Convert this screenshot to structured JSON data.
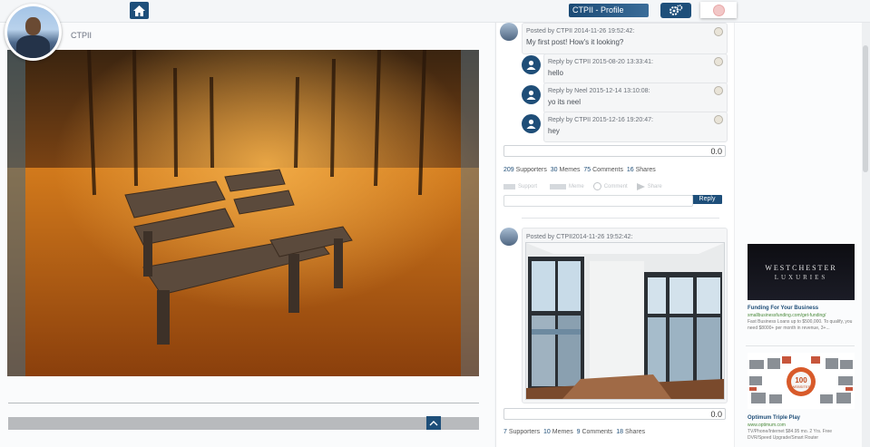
{
  "app": {
    "profile_button": "CTPII - Profile",
    "username": "CTPII"
  },
  "posts": [
    {
      "meta": "Posted by CTPII 2014-11-26 19:52:42:",
      "message": "My first post! How's it looking?",
      "replies": [
        {
          "meta": "Reply by CTPII 2015-08-20 13:33:41:",
          "text": "hello"
        },
        {
          "meta": "Reply by Neel 2015-12-14 13:10:08:",
          "text": "yo its neel"
        },
        {
          "meta": "Reply by CTPII 2015-12-16 19:20:47:",
          "text": "hey"
        }
      ],
      "rating": "0.0",
      "stats": {
        "supporters": "209",
        "supporters_label": "Supporters",
        "memes": "30",
        "memes_label": "Memes",
        "comments": "75",
        "comments_label": "Comments",
        "shares": "16",
        "shares_label": "Shares"
      },
      "actions": {
        "support": "Support",
        "meme": "Meme",
        "comment": "Comment",
        "share": "Share"
      },
      "reply_button": "Reply"
    },
    {
      "meta": "Posted by CTPII2014-11-26 19:52:42:",
      "rating": "0.0",
      "stats": {
        "supporters": "7",
        "supporters_label": "Supporters",
        "memes": "10",
        "memes_label": "Memes",
        "comments": "9",
        "comments_label": "Comments",
        "shares": "18",
        "shares_label": "Shares"
      }
    }
  ],
  "ads": [
    {
      "banner": "WESTCHESTER",
      "banner_sub": "LUXURIES",
      "title": "Funding For Your Business",
      "url": "smallbusinessfunding.com/get-funding/",
      "text": "Fast Business Loans up to $500,000. To qualify, you need $8000+ per month in revenue, 3+..."
    },
    {
      "banner": "100",
      "banner_sub": "WEBSITES",
      "title": "Optimum Triple Play",
      "url": "www.optimum.com",
      "text": "TV/Phone/Internet $84.95 mo. 2 Yrs. Free DVR/Speed Upgrade/Smart Router"
    }
  ],
  "colors": {
    "primary": "#1e4f7a",
    "accent_link": "#1f4e78"
  }
}
